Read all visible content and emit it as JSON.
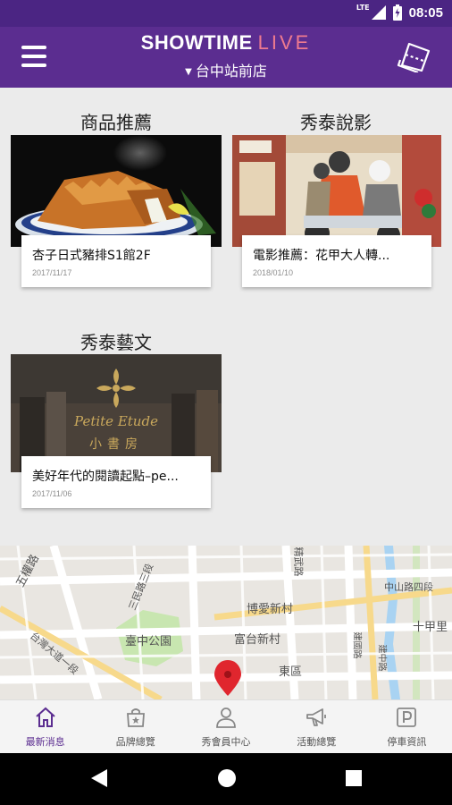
{
  "status_bar": {
    "time": "08:05",
    "network": "LTE"
  },
  "app_bar": {
    "brand_name": "SHOWTIME",
    "brand_live": "LIVE",
    "branch": "台中站前店",
    "menu_icon": "hamburger-menu-icon",
    "ticket_icon": "ticket-icon"
  },
  "sections": {
    "products": {
      "title": "商品推薦",
      "card": {
        "title": "杏子日式豬排S1館2F",
        "date": "2017/11/17"
      }
    },
    "movies": {
      "title": "秀泰說影",
      "card": {
        "title": "電影推薦：花甲大人轉...",
        "date": "2018/01/10"
      }
    },
    "arts": {
      "title": "秀泰藝文",
      "card": {
        "title": "美好年代的閱讀起點–pe...",
        "date": "2017/11/06"
      },
      "image_text": {
        "line1": "Petite Etude",
        "line2": "小書房"
      }
    }
  },
  "map": {
    "labels": {
      "wuquan": "五權路",
      "sanmin": "三民路三段",
      "jingwu": "精武路",
      "zhongshan": "中山路四段",
      "shijia": "十甲里",
      "boai": "博愛新村",
      "taiwan": "台灣大道一段",
      "park": "臺中公園",
      "futai": "富台新村",
      "dongqu": "東區",
      "jianguo": "建國路",
      "jianzhong": "建中路"
    },
    "colors": {
      "road_major": "#ffffff",
      "road_yellow": "#f7d98b",
      "park": "#c8e6b0",
      "water": "#a9d3f2",
      "pin": "#e0262e"
    }
  },
  "bottom_nav": {
    "items": [
      {
        "label": "最新消息",
        "icon": "home-icon"
      },
      {
        "label": "品牌總覽",
        "icon": "shop-bag-icon"
      },
      {
        "label": "秀會員中心",
        "icon": "member-icon"
      },
      {
        "label": "活動總覽",
        "icon": "megaphone-icon"
      },
      {
        "label": "停車資訊",
        "icon": "parking-icon"
      }
    ],
    "active_color": "#5b2d90"
  },
  "theme": {
    "primary": "#5b2d90",
    "status_bar": "#4b2583",
    "accent_pink": "#ee7a8f"
  }
}
